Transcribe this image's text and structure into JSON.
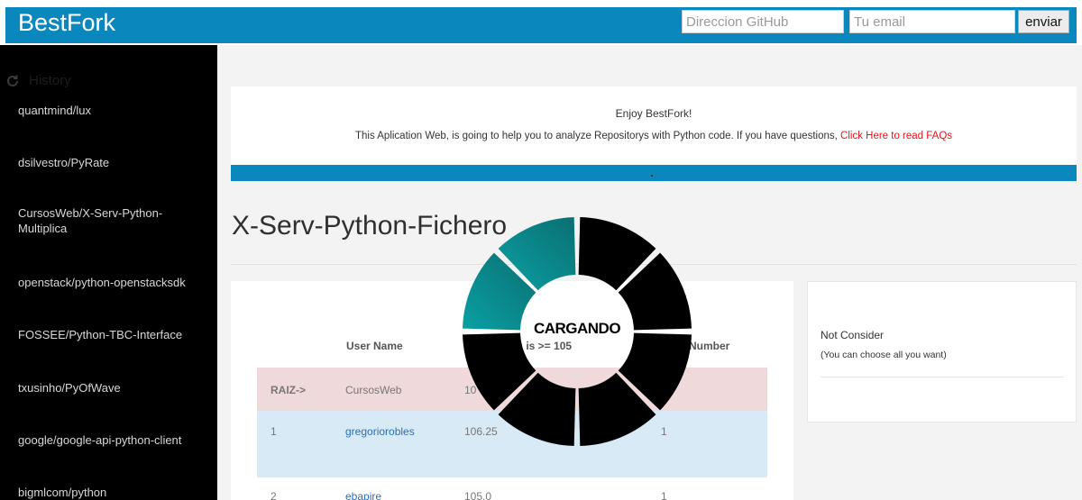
{
  "header": {
    "brand": "BestFork",
    "github_placeholder": "Direccion GitHub",
    "email_placeholder": "Tu email",
    "send_label": "enviar"
  },
  "sidebar": {
    "history_label": "History",
    "items": [
      "quantmind/lux",
      "dsilvestro/PyRate",
      "CursosWeb/X-Serv-Python-Multiplica",
      "openstack/python-openstacksdk",
      "FOSSEE/Python-TBC-Interface",
      "txusinho/PyOfWave",
      "google/google-api-python-client",
      "bigmlcom/python"
    ]
  },
  "welcome": {
    "title": "Enjoy BestFork!",
    "text": "This Aplication Web, is going to help you to analyze Repositorys with Python code. If you have questions,",
    "faq_link": "Click Here to read FAQs",
    "bar_dot": "."
  },
  "repo": {
    "title": "X-Serv-Python-Fichero"
  },
  "table": {
    "headers": {
      "user_name": "User Name",
      "score_partial": ": is >= 105",
      "number_partial": "Number"
    },
    "rows": [
      {
        "label": "RAIZ->",
        "user": "CursosWeb",
        "score": "10",
        "number": ""
      },
      {
        "label": "1",
        "user": "gregoriorobles",
        "score": "106.25",
        "number": "1"
      },
      {
        "label": "2",
        "user": "ebapire",
        "score": "105.0",
        "number": "1"
      }
    ]
  },
  "filter": {
    "title": "Not Consider",
    "subtitle": "(You can choose all you want)"
  },
  "loader": {
    "text": "CARGANDO",
    "accent_color": "#0aa0a3",
    "segment_color": "#000000"
  }
}
